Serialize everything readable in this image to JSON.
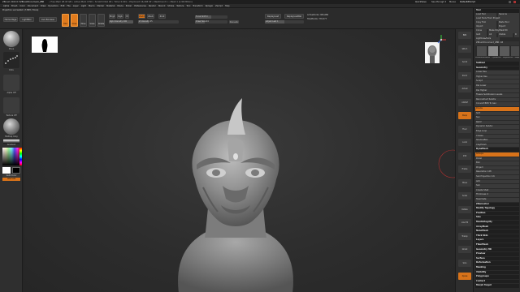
{
  "titlebar": {
    "app": "ZBrush 2022.0.5",
    "document": "ZBrushDocument_ZBR",
    "stats": "• Free Mem 28.43 GB • Active Mem 1790 • Scratch Disk 48 • Timer 0.001 • PolyCount 16,248 KP • MeshCount 1 • Mesh 1 (1.96 Million)",
    "quicksave": "QuickSave",
    "see_through": "See-through 0",
    "menus_label": "Menus",
    "default_script": "DefaultZScript"
  },
  "menubar": {
    "items": [
      "Alpha",
      "Brush",
      "Color",
      "Document",
      "Draw",
      "Dynamics",
      "Edit",
      "File",
      "Layer",
      "Light",
      "Macro",
      "Marker",
      "Material",
      "Movie",
      "Picker",
      "Preferences",
      "Render",
      "Stencil",
      "Stroke",
      "Texture",
      "Tool",
      "Transform",
      "Zplugin",
      "Zscript",
      "Help"
    ]
  },
  "toolbar": {
    "home_page": "Home Page",
    "lightbox": "LightBox",
    "live_boolean": "Live Boolean",
    "edit": "Edit",
    "draw": "Draw",
    "move": "Move",
    "scale": "Scale",
    "rotate": "Rotate",
    "mrgb": "Mrgb",
    "rgb": "Rgb",
    "m": "M",
    "zadd": "Zadd",
    "zsub": "Zsub",
    "zcut": "Zcut",
    "rgb_intensity": "Rgb Intensity 100",
    "z_intensity": "Z Intensity 25",
    "focal_shift": "Focal Shift 0",
    "draw_size": "Draw Size 64",
    "dynamic": "Dynamic",
    "replay_last": "ReplayLast",
    "replay_last_rel": "ReplayLastRel",
    "active_points": "ActivePoints: 984,686",
    "total_points": "TotalPoints: 776,577",
    "adjust_last": "Adjust Last 1",
    "notice": "Projection succeeded. (7,808 / Done)"
  },
  "leftshelf": {
    "brush_label": "Move",
    "stroke_label": "Dots",
    "alpha_label": "Alpha Off",
    "texture_label": "Texture Off",
    "material_label": "MatCap Gray",
    "gradient_label": "Gradient",
    "switch_color": "SwitchColor",
    "alternate": "Alternate",
    "swatch_main": "#ffffff",
    "swatch_sec": "#000000"
  },
  "rightshelf": {
    "buttons": [
      "BPR",
      "SPix 3",
      "Scroll",
      "Zoom",
      "Actual",
      "AAHalf",
      "Persp",
      "Floor",
      "Local",
      "XYZ",
      "Frame",
      "Move",
      "Scale",
      "Rotate",
      "Line Fill",
      "Transp",
      "Ghost",
      "Solo",
      "Xpose"
    ]
  },
  "toolpal": {
    "title": "Tool",
    "load_tool": "Load Tool",
    "save_as": "Save As",
    "load_project": "Load Tools From Project",
    "copy_tool": "Copy Tool",
    "paste_tool": "Paste Tool",
    "import": "Import",
    "export": "Export",
    "clone": "Clone",
    "make_polymesh": "Make PolyMesh3D",
    "goz": "GoZ",
    "all": "All",
    "visible": "Visible",
    "r": "R",
    "lightbox_tools": "Lightbox▸Tools",
    "current_tool": "ZBrushDocument_ZBR: 48",
    "tool_thumbs": [
      "ZBrushDocument",
      "Cylinder3D",
      "PolyMesh3D",
      "SimpleBrush"
    ],
    "sections": [
      "Subtool",
      "Geometry",
      "Lower Res",
      "Higher Res",
      "Sculpt",
      "Del Lower",
      "Del Higher",
      "Freeze SubDivision Levels",
      "Reconstruct Subdiv",
      "Convert BPR To Geo",
      "Divide",
      "Smt",
      "Suv",
      "ReUV",
      "Dynamic Subdiv",
      "Edge Loop",
      "Crease",
      "ShadowBox",
      "ClayPolish",
      "DynaMesh",
      "Groups",
      "Polish",
      "Blur",
      "Project",
      "Resolution 128",
      "Sub Projection 0.6",
      "Add",
      "Sub",
      "Create Shell",
      "Thickness 4",
      "Tessimate",
      "ZRemesher",
      "Modify Topology",
      "Position",
      "Size",
      "MeshIntegrity",
      "ArrayMesh",
      "NanoMesh",
      "Thick Skin",
      "Layers",
      "FiberMesh",
      "Geometry HD",
      "Preview",
      "Surface",
      "Deformation",
      "Masking",
      "Visibility",
      "Polygroups",
      "Contact",
      "Morph Target"
    ]
  }
}
